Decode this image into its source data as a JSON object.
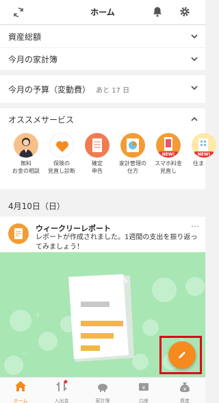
{
  "header": {
    "title": "ホーム"
  },
  "rows": {
    "assets": "資産総額",
    "monthly_book": "今月の家計簿",
    "budget": "今月の予算（変動費）",
    "budget_sub": "あと 17 日"
  },
  "services": {
    "heading": "オススメサービス",
    "items": [
      {
        "label": "無料\nお金の相談"
      },
      {
        "label": "保険の\n見直し診断"
      },
      {
        "label": "確定\n申告"
      },
      {
        "label": "家計管理の\n仕方"
      },
      {
        "label": "スマホ料金\n見直し",
        "badge": "NEW!"
      },
      {
        "label": "住ま",
        "badge": "NEW!"
      }
    ]
  },
  "date": "4月10日（日）",
  "report_card": {
    "title": "ウィークリーレポート",
    "text": "レポートが作成されました。1週間の支出を振り返ってみましょう！",
    "more": "…"
  },
  "tabs": [
    {
      "label": "ホーム",
      "active": true
    },
    {
      "label": "入出金"
    },
    {
      "label": "家計簿"
    },
    {
      "label": "口座"
    },
    {
      "label": "資産"
    }
  ],
  "colors": {
    "accent": "#f58a1f",
    "banner": "#a8e6b4",
    "highlight_frame": "#e0001b"
  }
}
